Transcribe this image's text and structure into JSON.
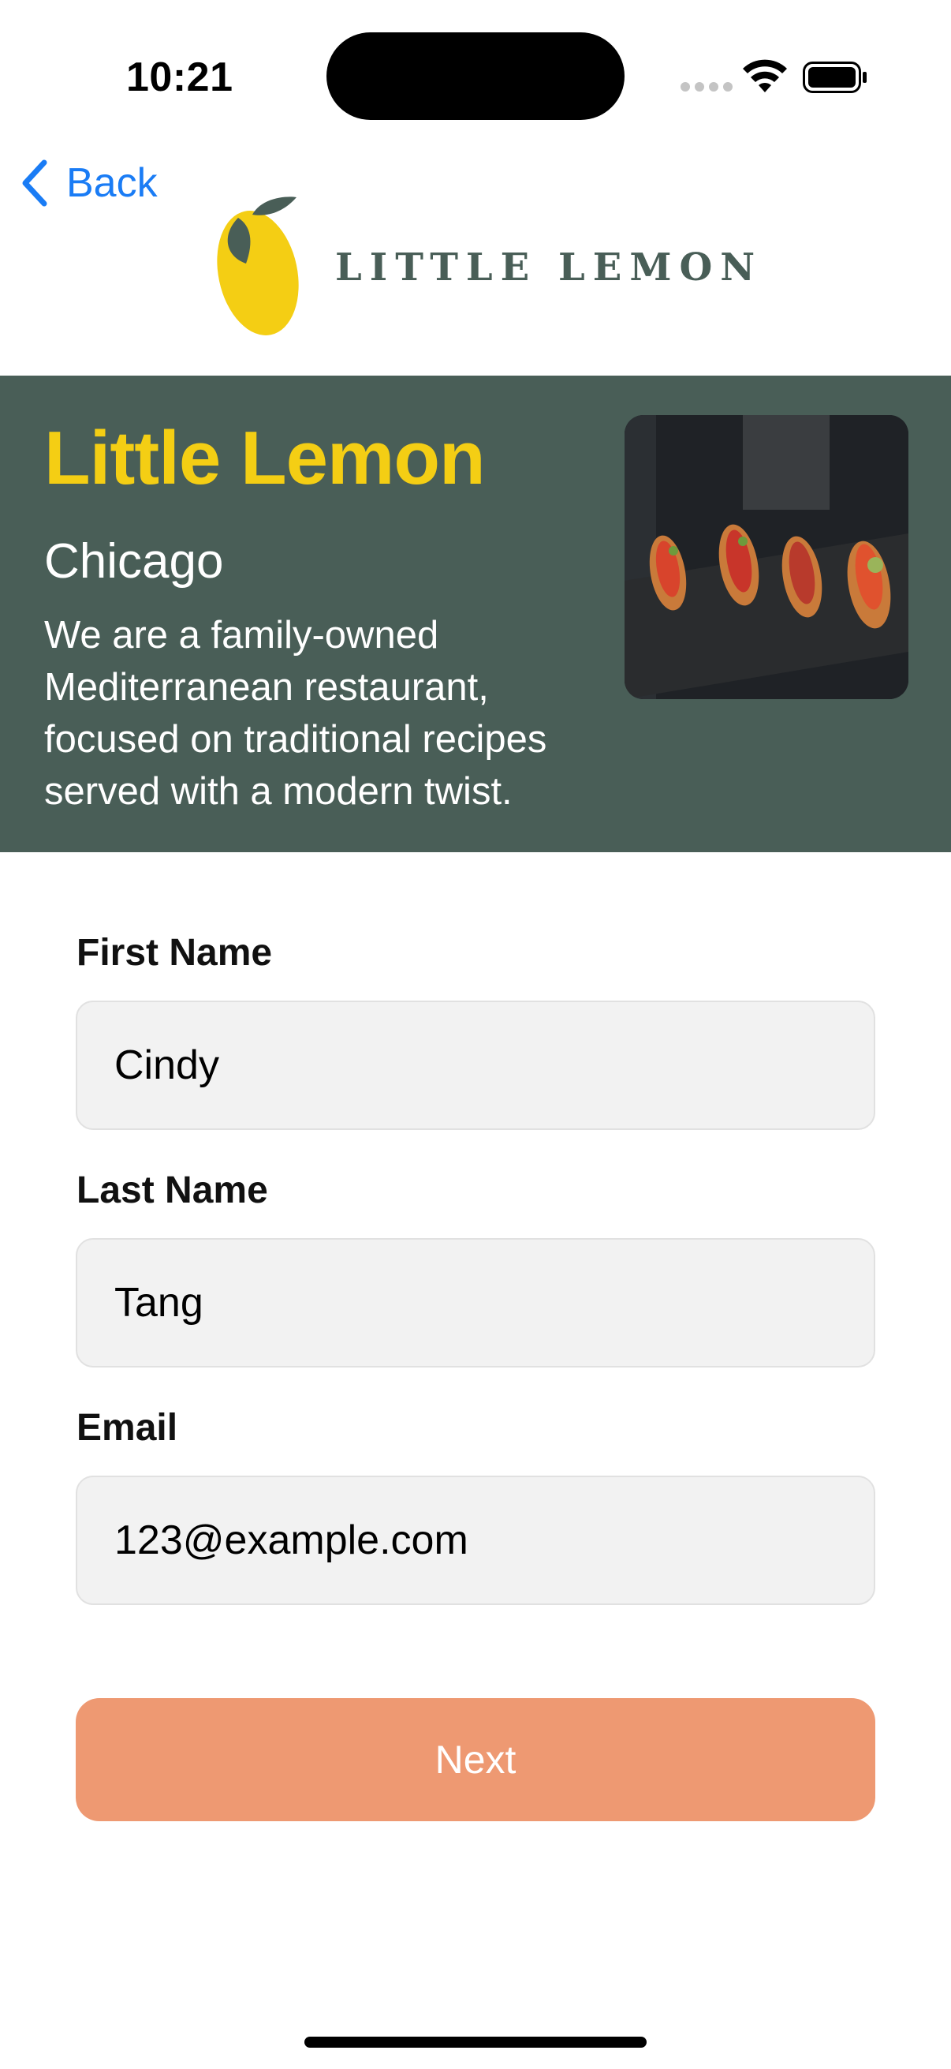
{
  "status_bar": {
    "time": "10:21"
  },
  "nav": {
    "back_label": "Back",
    "back_icon": "chevron-left-icon",
    "accent_color": "#1a7cf5"
  },
  "logo": {
    "text": "LITTLE LEMON",
    "icon": "lemon-icon"
  },
  "hero": {
    "title": "Little Lemon",
    "city": "Chicago",
    "description": "We are a family-owned Mediterranean restaurant, focused on traditional recipes served with a modern twist.",
    "background_color": "#495e57",
    "title_color": "#f4ce14"
  },
  "form": {
    "first_name": {
      "label": "First Name",
      "value": "Cindy"
    },
    "last_name": {
      "label": "Last Name",
      "value": "Tang"
    },
    "email": {
      "label": "Email",
      "value": "123@example.com"
    }
  },
  "next_button": {
    "label": "Next",
    "color": "#ee9972"
  }
}
